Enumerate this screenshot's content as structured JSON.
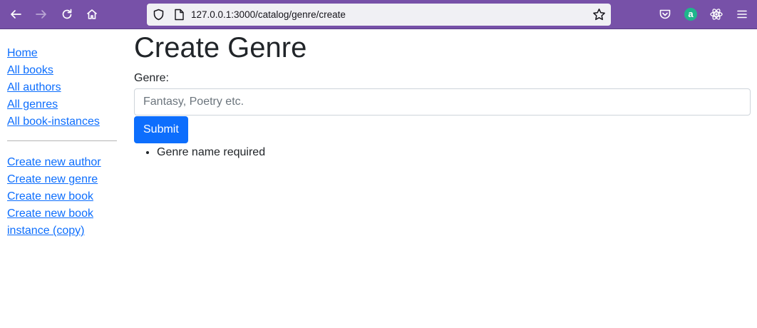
{
  "browser": {
    "url": "127.0.0.1:3000/catalog/genre/create",
    "toolbar_color": "#7751a8",
    "icons": [
      "back-arrow-icon",
      "forward-arrow-icon",
      "reload-icon",
      "home-icon",
      "shield-icon",
      "page-icon",
      "star-icon",
      "pocket-icon",
      "amazon-extension-icon",
      "react-devtools-icon",
      "hamburger-menu-icon"
    ],
    "amazon_ext_letter": "a"
  },
  "sidebar": {
    "nav_links": [
      {
        "label": "Home"
      },
      {
        "label": "All books"
      },
      {
        "label": "All authors"
      },
      {
        "label": "All genres"
      },
      {
        "label": "All book-instances"
      }
    ],
    "create_links": [
      {
        "label": "Create new author"
      },
      {
        "label": "Create new genre"
      },
      {
        "label": "Create new book"
      },
      {
        "label": "Create new book instance (copy)"
      }
    ]
  },
  "main": {
    "title": "Create Genre",
    "form": {
      "label": "Genre:",
      "value": "",
      "placeholder": "Fantasy, Poetry etc.",
      "submit_label": "Submit"
    },
    "errors": [
      "Genre name required"
    ]
  },
  "colors": {
    "link": "#0d6efd",
    "primary_button": "#0d6efd",
    "text": "#212529"
  }
}
